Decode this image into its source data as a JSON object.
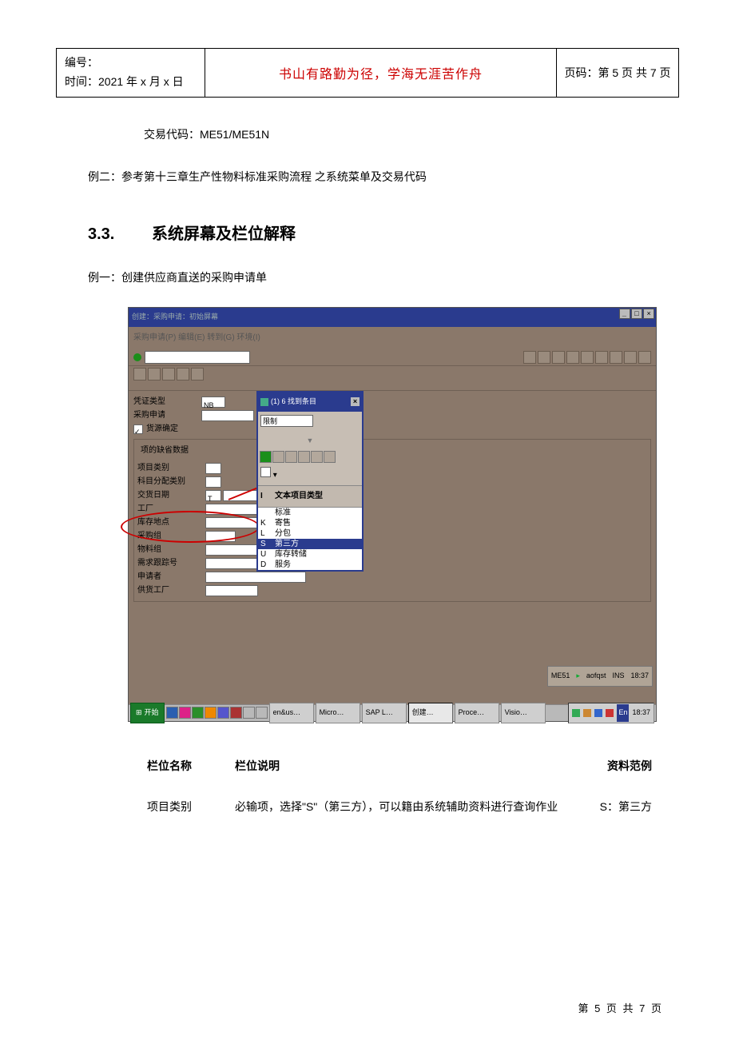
{
  "header": {
    "bianhao_label": "编号：",
    "time_label": "时间：",
    "time_value": "2021 年 x 月 x 日",
    "motto": "书山有路勤为径，学海无涯苦作舟",
    "page_label": "页码：第 5 页  共 7 页"
  },
  "content": {
    "tx_code_line": "交易代码：ME51/ME51N",
    "example2": "例二：参考第十三章生产性物料标准采购流程 之系统菜单及交易代码",
    "section_num": "3.3.",
    "section_title": "系统屏幕及栏位解释",
    "example1": "例一：创建供应商直送的采购申请单"
  },
  "sap": {
    "win_title": "创建：采购申请：初始屏幕",
    "menu": "采购申请(P)  编辑(E)  转到(G)  环境(I)",
    "doc_type_label": "凭证类型",
    "doc_type_value": "NB",
    "pr_label": "采购申请",
    "source_label": "货源确定",
    "group_title": "项的缺省数据",
    "fields": {
      "item_cat": "项目类别",
      "acct_assign": "科目分配类别",
      "deliv_date": "交货日期",
      "deliv_date_val": "T",
      "plant": "工厂",
      "stor_loc": "库存地点",
      "purch_group": "采购组",
      "mat_group": "物料组",
      "req_track": "需求跟踪号",
      "requester": "申请者",
      "supply_plant": "供货工厂"
    },
    "popup": {
      "title_count": "(1)   6 找到条目",
      "restrict": "限制",
      "col_code": "I",
      "col_text": "文本项目类型",
      "items": [
        {
          "code": "",
          "text": "标准"
        },
        {
          "code": "K",
          "text": "寄售"
        },
        {
          "code": "L",
          "text": "分包"
        },
        {
          "code": "S",
          "text": "第三方"
        },
        {
          "code": "U",
          "text": "库存转储"
        },
        {
          "code": "D",
          "text": "服务"
        }
      ],
      "selected_index": 3
    },
    "status": {
      "sid": "ME51",
      "client": "aofqst",
      "mode": "INS",
      "time": "18:37"
    },
    "taskbar": {
      "start": "开始",
      "tasks": [
        "en&us…",
        "Micro…",
        "SAP L…",
        "创建…",
        "Proce…",
        "Visio…"
      ],
      "active_index": 3,
      "lang": "En",
      "clock": "18:37"
    }
  },
  "table": {
    "h1": "栏位名称",
    "h2": "栏位说明",
    "h3": "资料范例",
    "r1_name": "项目类别",
    "r1_desc": "必输项，选择\"S\"（第三方），可以籍由系统辅助资料进行查询作业",
    "r1_example": "S：第三方"
  },
  "footer": "第 5 页 共 7 页"
}
